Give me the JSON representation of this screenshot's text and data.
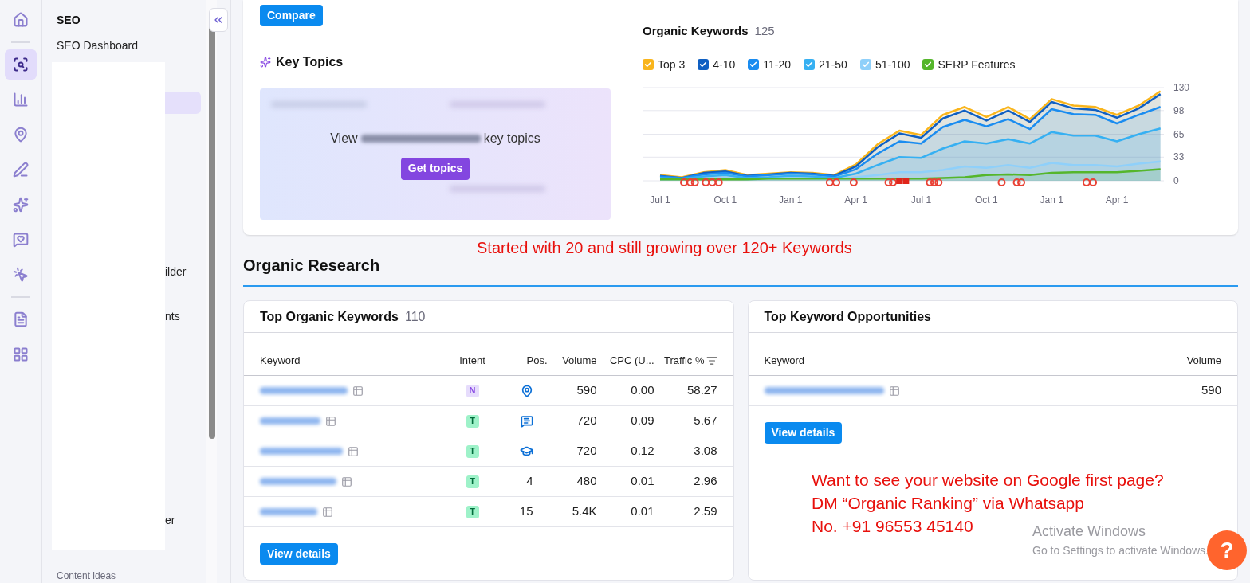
{
  "icon_rail": [
    {
      "kind": "home",
      "selected": false
    },
    {
      "kind": "divider"
    },
    {
      "kind": "seo",
      "selected": true
    },
    {
      "kind": "bars",
      "selected": false
    },
    {
      "kind": "pin",
      "selected": false
    },
    {
      "kind": "pen",
      "selected": false
    },
    {
      "kind": "sparkle_chart",
      "selected": false
    },
    {
      "kind": "heart_chat",
      "selected": false
    },
    {
      "kind": "cursor_target",
      "selected": false
    },
    {
      "kind": "divider"
    },
    {
      "kind": "document",
      "selected": false
    },
    {
      "kind": "apps",
      "selected": false
    }
  ],
  "sidebar": {
    "section": "SEO",
    "items": [
      {
        "label": "SEO Dashboard",
        "selected": false
      },
      {
        "selected": true
      },
      {
        "label": "ilder",
        "selected": false
      },
      {
        "label": "nts",
        "selected": false
      },
      {
        "label": "er",
        "selected": false
      }
    ],
    "footer": "Content ideas"
  },
  "top_card": {
    "compare_button": "Compare",
    "key_topics": {
      "title": "Key Topics",
      "view_prefix": "View",
      "view_suffix": "key topics",
      "button": "Get topics"
    },
    "organic_keywords": {
      "title": "Organic Keywords",
      "count": "125",
      "legend": [
        {
          "checked": true
        },
        {
          "checked": true
        },
        {
          "checked": true
        },
        {
          "checked": true
        },
        {
          "checked": true
        },
        {
          "checked": true
        }
      ],
      "chart_data": {
        "type": "area",
        "categories": [
          "Jul 1",
          null,
          null,
          "Oct 1",
          null,
          null,
          "Jan 1",
          null,
          null,
          "Apr 1",
          null,
          null,
          "Jul 1",
          null,
          null,
          "Oct 1",
          null,
          null,
          "Jan 1",
          null,
          null,
          "Apr 1",
          null,
          null
        ],
        "ylim": [
          0,
          130
        ],
        "yticks": [
          0,
          33,
          65,
          98,
          130
        ],
        "stacked": false,
        "grid": true,
        "series": [
          {
            "name": "Top 3",
            "color": "#f9b51c",
            "values": [
              8,
              5,
              12,
              15,
              8,
              10,
              12,
              11,
              8,
              23,
              51,
              70,
              64,
              92,
              103,
              89,
              103,
              86,
              114,
              105,
              103,
              92,
              105,
              125
            ]
          },
          {
            "name": "4-10",
            "color": "#0f5fc2",
            "values": [
              7,
              4,
              11,
              13,
              7,
              9,
              11,
              10,
              7,
              20,
              47,
              66,
              60,
              87,
              98,
              84,
              98,
              82,
              110,
              101,
              99,
              88,
              101,
              121
            ]
          },
          {
            "name": "11-20",
            "color": "#1a8cf0",
            "values": [
              6,
              4,
              9,
              11,
              6,
              8,
              10,
              9,
              6,
              16,
              38,
              55,
              52,
              75,
              85,
              76,
              86,
              72,
              100,
              93,
              92,
              80,
              92,
              103
            ]
          },
          {
            "name": "21-50",
            "color": "#36b0f2",
            "values": [
              4,
              3,
              6,
              8,
              4,
              5,
              7,
              6,
              4,
              10,
              22,
              33,
              32,
              45,
              55,
              52,
              58,
              52,
              68,
              63,
              63,
              55,
              65,
              73
            ]
          },
          {
            "name": "51-100",
            "color": "#8fd0fa",
            "values": [
              2,
              2,
              3,
              4,
              2,
              3,
              4,
              3,
              2,
              5,
              8,
              12,
              12,
              15,
              20,
              18,
              22,
              18,
              25,
              22,
              22,
              20,
              24,
              27
            ]
          },
          {
            "name": "SERP Features",
            "color": "#55b62b",
            "values": [
              2,
              2,
              2,
              2,
              2,
              3,
              3,
              3,
              3,
              3,
              3,
              3,
              3,
              4,
              5,
              8,
              9,
              8,
              11,
              12,
              12,
              12,
              14,
              16
            ]
          }
        ]
      }
    }
  },
  "promo_line": "Started with 20 and still growing over 120+ Keywords",
  "section_title": "Organic Research",
  "top_keywords": {
    "title": "Top Organic Keywords",
    "count": "110",
    "columns": [
      "Keyword",
      "Intent",
      "Pos.",
      "Volume",
      "CPC (U...",
      "Traffic %"
    ],
    "rows": [
      {
        "intent": "N",
        "kind": "navigational",
        "pos": {
          "kind": "local_pack"
        },
        "volume": "590",
        "cpc": "0.00",
        "traffic": "58.27"
      },
      {
        "intent": "T",
        "kind": "transactional",
        "pos": {
          "kind": "question"
        },
        "volume": "720",
        "cpc": "0.09",
        "traffic": "5.67"
      },
      {
        "intent": "T",
        "kind": "transactional",
        "pos": {
          "kind": "education"
        },
        "volume": "720",
        "cpc": "0.12",
        "traffic": "3.08"
      },
      {
        "intent": "T",
        "kind": "transactional",
        "pos": {
          "kind": "number",
          "text": "4"
        },
        "volume": "480",
        "cpc": "0.01",
        "traffic": "2.96"
      },
      {
        "intent": "T",
        "kind": "transactional",
        "pos": {
          "kind": "number",
          "text": "15"
        },
        "volume": "5.4K",
        "cpc": "0.01",
        "traffic": "2.59"
      }
    ],
    "button": "View details"
  },
  "opportunities": {
    "title": "Top Keyword Opportunities",
    "columns": [
      "Keyword",
      "Volume"
    ],
    "rows": [
      {
        "volume": "590"
      }
    ],
    "button": "View details"
  },
  "promo_block": [
    "Want to see your website on Google first page?",
    "DM “Organic Ranking” via Whatsapp",
    "No. +91 96553 45140"
  ],
  "windows_notice": {
    "title": "Activate Windows",
    "subtitle": "Go to Settings to activate Windows."
  },
  "help_button": "?"
}
